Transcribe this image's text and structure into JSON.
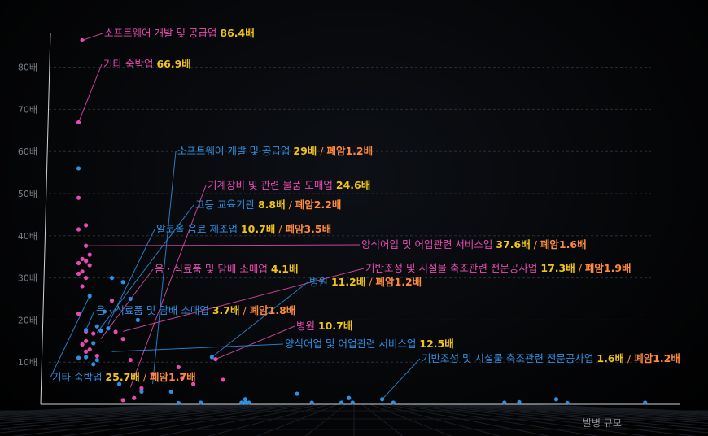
{
  "chart_data": {
    "type": "scatter",
    "xlabel": "발병 규모",
    "ylabel": "",
    "y_tick_labels": [
      "10배",
      "20배",
      "30배",
      "40배",
      "50배",
      "60배",
      "70배",
      "80배"
    ],
    "ylim": [
      0,
      90
    ],
    "grid": true,
    "colors": {
      "pink": "#e84bb0",
      "blue": "#2f8fe0",
      "gold": "#f0c419",
      "orange": "#ff8a3d",
      "white": "#ffffff"
    },
    "series": [
      {
        "color": "#e84bb0",
        "points": [
          [
            0.2,
            86.4
          ],
          [
            0.1,
            66.9
          ],
          [
            0.1,
            49
          ],
          [
            0.3,
            42.5
          ],
          [
            0.1,
            41.5
          ],
          [
            0.3,
            37.6
          ],
          [
            0.4,
            35.5
          ],
          [
            0.2,
            34.5
          ],
          [
            0.3,
            34
          ],
          [
            0.1,
            33.5
          ],
          [
            0.4,
            33
          ],
          [
            0.2,
            31.5
          ],
          [
            0.1,
            31
          ],
          [
            0.3,
            30
          ],
          [
            0.2,
            28
          ],
          [
            0.1,
            21.5
          ],
          [
            0.3,
            17.3
          ],
          [
            0.5,
            16.8
          ],
          [
            0.3,
            15
          ],
          [
            0.2,
            14.2
          ],
          [
            0.4,
            13
          ],
          [
            0.3,
            12.5
          ],
          [
            1.0,
            24.6
          ],
          [
            1.1,
            17.2
          ],
          [
            0.7,
            17.5
          ],
          [
            1.3,
            15.5
          ],
          [
            0.6,
            11.5
          ],
          [
            1.5,
            10.5
          ],
          [
            1.8,
            3.8
          ],
          [
            1.6,
            1.5
          ],
          [
            1.3,
            1
          ],
          [
            2.1,
            7.2
          ],
          [
            2.9,
            6.2
          ],
          [
            3.2,
            4.8
          ],
          [
            4.0,
            5.8
          ],
          [
            3.8,
            10.7
          ],
          [
            2.8,
            8.8
          ]
        ]
      },
      {
        "color": "#2f8fe0",
        "points": [
          [
            0.1,
            56
          ],
          [
            0.4,
            25.7
          ],
          [
            0.6,
            18.5
          ],
          [
            0.7,
            17.5
          ],
          [
            0.9,
            18
          ],
          [
            0.3,
            17.6
          ],
          [
            0.5,
            14.5
          ],
          [
            0.1,
            11
          ],
          [
            0.3,
            11.2
          ],
          [
            0.6,
            10.5
          ],
          [
            1.0,
            30
          ],
          [
            1.3,
            29
          ],
          [
            1.5,
            25
          ],
          [
            1.7,
            20
          ],
          [
            0.8,
            22
          ],
          [
            0.5,
            9.5
          ],
          [
            2.6,
            3
          ],
          [
            2.8,
            0.3
          ],
          [
            3.4,
            0.4
          ],
          [
            4.5,
            0.4
          ],
          [
            4.6,
            1.2
          ],
          [
            4.7,
            0.4
          ],
          [
            4.6,
            0.4
          ],
          [
            6.0,
            2.5
          ],
          [
            6.4,
            0.4
          ],
          [
            7.2,
            0.4
          ],
          [
            7.4,
            1.5
          ],
          [
            7.5,
            0.4
          ],
          [
            8.3,
            1.2
          ],
          [
            8.6,
            0.4
          ],
          [
            11.6,
            0.4
          ],
          [
            12.0,
            0.5
          ],
          [
            13.0,
            1.2
          ],
          [
            13.3,
            0.3
          ],
          [
            15.4,
            0.4
          ],
          [
            1.2,
            4.8
          ],
          [
            1.8,
            3
          ],
          [
            3.7,
            11.2
          ]
        ]
      }
    ],
    "annotations": [
      {
        "name": "소프트웨어 개발 및 공급업",
        "value": "86.4배",
        "extra": "",
        "series_color": "#e84bb0",
        "label_color": "#e84bb0",
        "value_color": "#f0c419",
        "point": [
          0.2,
          86.4
        ]
      },
      {
        "name": "기타 숙박업",
        "value": "66.9배",
        "extra": "",
        "series_color": "#e84bb0",
        "label_color": "#e84bb0",
        "value_color": "#f0c419",
        "point": [
          0.1,
          66.9
        ]
      },
      {
        "name": "소프트웨어 개발 및 공급업",
        "value": "29배",
        "extra": "폐암1.2배",
        "series_color": "#2f8fe0",
        "label_color": "#2f8fe0",
        "value_color": "#f0c419",
        "point": [
          2.1,
          4.8
        ]
      },
      {
        "name": "기계장비 및 관련 물품 도매업",
        "value": "24.6배",
        "extra": "",
        "series_color": "#e84bb0",
        "label_color": "#e84bb0",
        "value_color": "#f0c419",
        "point": [
          1.5,
          4
        ]
      },
      {
        "name": "고등 교육기관",
        "value": "8.8배",
        "extra": "폐암2.2배",
        "series_color": "#2f8fe0",
        "label_color": "#2f8fe0",
        "value_color": "#f0c419",
        "point": [
          0.6,
          17
        ]
      },
      {
        "name": "알코올 음료 제조업",
        "value": "10.7배",
        "extra": "폐암3.5배",
        "series_color": "#2f8fe0",
        "label_color": "#2f8fe0",
        "value_color": "#f0c419",
        "point": [
          0.9,
          19
        ]
      },
      {
        "name": "양식어업 및 어업관련 서비스업",
        "value": "37.6배",
        "extra": "폐암1.6배",
        "series_color": "#e84bb0",
        "label_color": "#e84bb0",
        "value_color": "#f0c419",
        "point": [
          0.3,
          37.6
        ]
      },
      {
        "name": "음 · 식료품 및 담배 소매업",
        "value": "4.1배",
        "extra": "",
        "series_color": "#e84bb0",
        "label_color": "#e84bb0",
        "value_color": "#f0c419",
        "point": [
          0.7,
          15.5
        ]
      },
      {
        "name": "기반조성 및 시설물 축조관련 전문공사업",
        "value": "17.3배",
        "extra": "폐암1.9배",
        "series_color": "#e84bb0",
        "label_color": "#e84bb0",
        "value_color": "#f0c419",
        "point": [
          1.3,
          17.3
        ]
      },
      {
        "name": "병원",
        "value": "11.2배",
        "extra": "폐암1.2배",
        "series_color": "#2f8fe0",
        "label_color": "#2f8fe0",
        "value_color": "#f0c419",
        "point": [
          3.7,
          11.2
        ]
      },
      {
        "name": "음 · 식료품 및 담배 소매업",
        "value": "3.7배",
        "extra": "폐암1.8배",
        "series_color": "#2f8fe0",
        "label_color": "#2f8fe0",
        "value_color": "#f0c419",
        "point": [
          0.3,
          17.6
        ]
      },
      {
        "name": "병원",
        "value": "10.7배",
        "extra": "",
        "series_color": "#e84bb0",
        "label_color": "#e84bb0",
        "value_color": "#f0c419",
        "point": [
          3.8,
          10.7
        ]
      },
      {
        "name": "양식어업 및 어업관련 서비스업",
        "value": "12.5배",
        "extra": "",
        "series_color": "#2f8fe0",
        "label_color": "#2f8fe0",
        "value_color": "#f0c419",
        "point": [
          1.0,
          12.5
        ]
      },
      {
        "name": "기반조성 및 시설물 축조관련 전문공사업",
        "value": "1.6배",
        "extra": "폐암1.2배",
        "series_color": "#2f8fe0",
        "label_color": "#2f8fe0",
        "value_color": "#f0c419",
        "point": [
          8.3,
          1.2
        ]
      },
      {
        "name": "기타 숙박업",
        "value": "25.7배",
        "extra": "폐암1.7배",
        "series_color": "#2f8fe0",
        "label_color": "#2f8fe0",
        "value_color": "#f0c419",
        "point": [
          0.4,
          25.7
        ]
      }
    ]
  }
}
